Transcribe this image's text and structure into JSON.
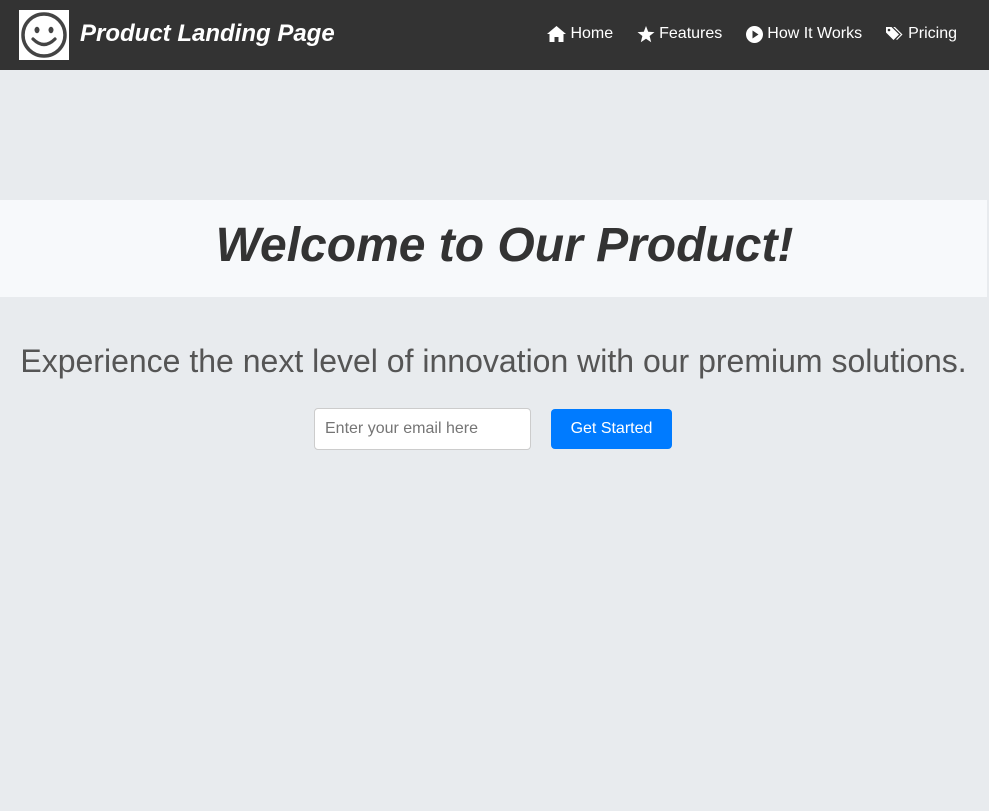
{
  "header": {
    "logo_icon": "smiley-face-icon",
    "brand_title": "Product Landing Page",
    "nav": [
      {
        "label": "Home",
        "icon": "home-icon"
      },
      {
        "label": "Features",
        "icon": "star-icon"
      },
      {
        "label": "How It Works",
        "icon": "play-circle-icon"
      },
      {
        "label": "Pricing",
        "icon": "tags-icon"
      }
    ]
  },
  "hero": {
    "headline": "Welcome to Our Product!",
    "tagline": "Experience the next level of innovation with our premium solutions."
  },
  "signup": {
    "email_placeholder": "Enter your email here",
    "email_value": "",
    "button_label": "Get Started"
  },
  "colors": {
    "navbar_bg": "#333333",
    "page_bg": "#e8ebee",
    "banner_bg": "#f7f9fb",
    "accent": "#007bff",
    "text_dark": "#333333"
  }
}
